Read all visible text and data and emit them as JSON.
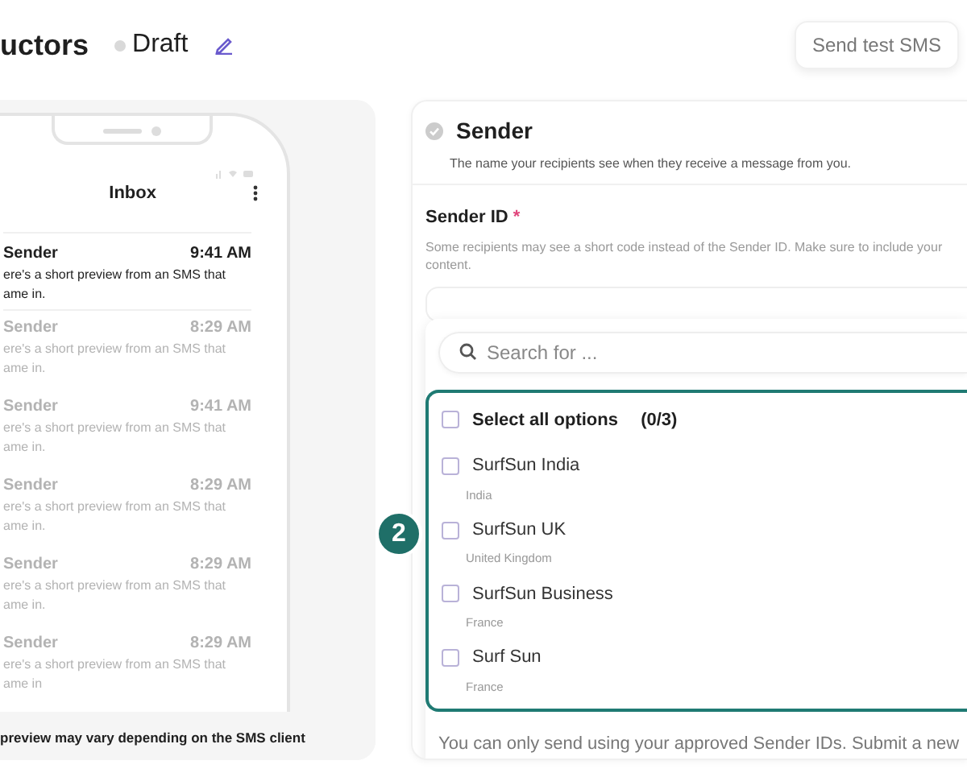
{
  "header": {
    "title": "uctors",
    "status": "Draft",
    "send_button": "Send test SMS"
  },
  "preview": {
    "inbox_title": "Inbox",
    "messages": [
      {
        "sender": "Sender",
        "time": "9:41 AM",
        "lines": [
          "ere's a short preview from an SMS that",
          "ame in."
        ],
        "unread": true
      },
      {
        "sender": "Sender",
        "time": "8:29 AM",
        "lines": [
          "ere's a short preview from an SMS that",
          "ame in."
        ],
        "unread": false
      },
      {
        "sender": "Sender",
        "time": "9:41 AM",
        "lines": [
          "ere's a short preview from an SMS that",
          "ame in."
        ],
        "unread": false
      },
      {
        "sender": "Sender",
        "time": "8:29 AM",
        "lines": [
          "ere's a short preview from an SMS that",
          "ame in."
        ],
        "unread": false
      },
      {
        "sender": "Sender",
        "time": "8:29 AM",
        "lines": [
          "ere's a short preview from an SMS that",
          "ame in."
        ],
        "unread": false
      },
      {
        "sender": "Sender",
        "time": "8:29 AM",
        "lines": [
          "ere's a short preview from an SMS that",
          "ame in"
        ],
        "unread": false
      }
    ],
    "caption": "preview may vary depending on the SMS client"
  },
  "sender_section": {
    "title": "Sender",
    "description": "The name your recipients see when they receive a message from you.",
    "field_label": "Sender ID",
    "required_mark": "*",
    "hint_lines": [
      "Some recipients may see a short code instead of the Sender ID. Make sure to include your",
      "content."
    ],
    "search": {
      "placeholder": "Search for ..."
    },
    "select_all": {
      "label": "Select all options",
      "count": "(0/3)",
      "checked": false
    },
    "options": [
      {
        "name": "SurfSun India",
        "country": "India",
        "checked": false
      },
      {
        "name": "SurfSun UK",
        "country": "United Kingdom",
        "checked": false
      },
      {
        "name": "SurfSun Business",
        "country": "France",
        "checked": false
      },
      {
        "name": "Surf Sun",
        "country": "France",
        "checked": false
      }
    ],
    "footer_text": "You can only send using your approved Sender IDs.",
    "footer_link": "Submit a new"
  },
  "step_badge": "2"
}
